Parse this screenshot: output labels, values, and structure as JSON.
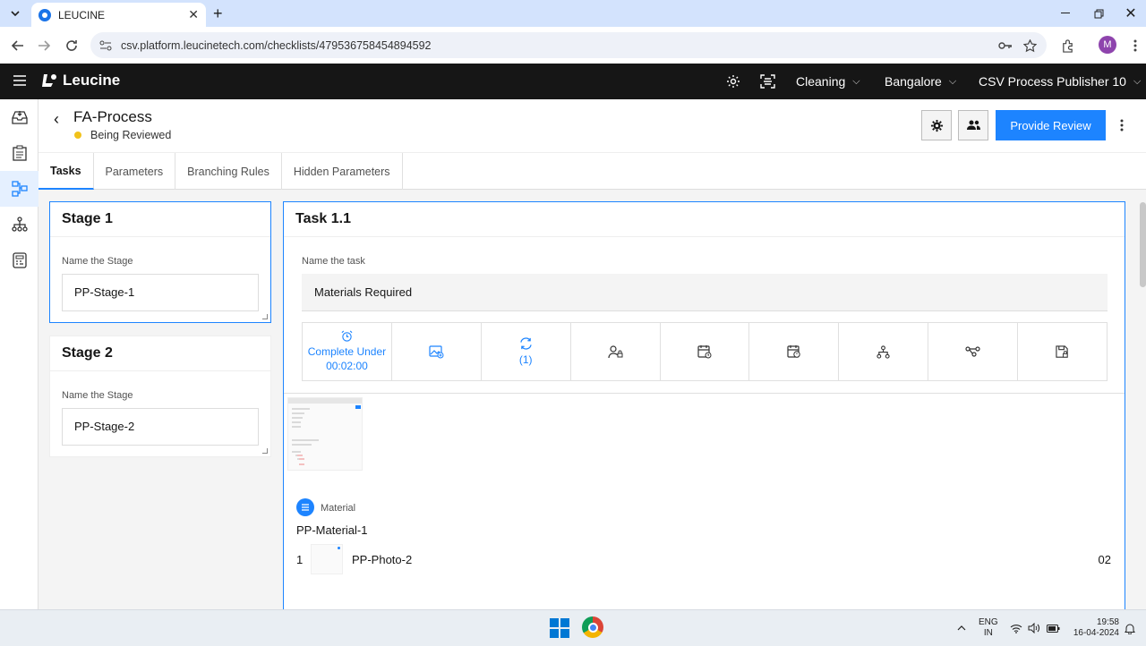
{
  "browser": {
    "tab_title": "LEUCINE",
    "url": "csv.platform.leucinetech.com/checklists/479536758454894592",
    "profile_initial": "M"
  },
  "header": {
    "brand": "Leucine",
    "dropdowns": [
      "Cleaning",
      "Bangalore",
      "CSV Process Publisher 10"
    ]
  },
  "page": {
    "title": "FA-Process",
    "status": "Being Reviewed",
    "primary_button": "Provide Review",
    "tabs": [
      "Tasks",
      "Parameters",
      "Branching Rules",
      "Hidden Parameters"
    ]
  },
  "stages": [
    {
      "title": "Stage 1",
      "field_label": "Name the Stage",
      "value": "PP-Stage-1"
    },
    {
      "title": "Stage 2",
      "field_label": "Name the Stage",
      "value": "PP-Stage-2"
    }
  ],
  "task": {
    "title": "Task 1.1",
    "field_label": "Name the task",
    "value": "Materials Required",
    "actions": {
      "timer_line1": "Complete Under",
      "timer_line2": "00:02:00",
      "recurrence": "(1)"
    },
    "material": {
      "label": "Material",
      "name": "PP-Material-1",
      "row": {
        "index": "1",
        "name": "PP-Photo-2",
        "qty": "02"
      }
    }
  },
  "system": {
    "lang_line1": "ENG",
    "lang_line2": "IN",
    "time": "19:58",
    "date": "16-04-2024"
  },
  "colors": {
    "accent": "#1d84ff",
    "header_bg": "#161616",
    "status_dot": "#f1c21b"
  }
}
